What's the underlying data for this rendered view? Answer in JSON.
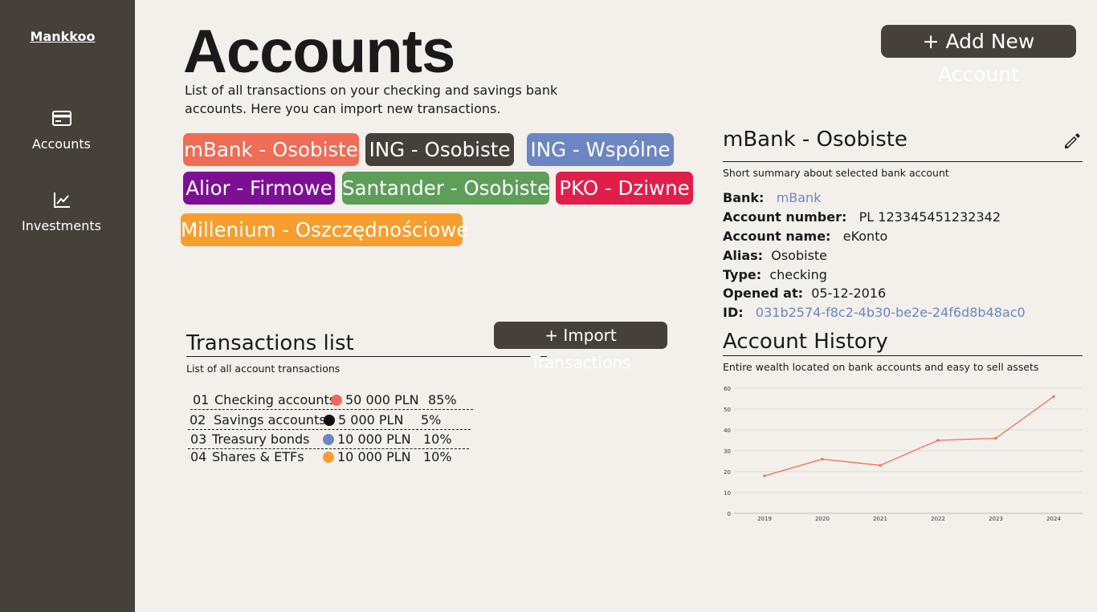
{
  "sidebar": {
    "logo": "Mankkoo",
    "items": [
      {
        "label": "Accounts",
        "icon": "credit-card-icon"
      },
      {
        "label": "Investments",
        "icon": "chart-line-icon"
      }
    ]
  },
  "header": {
    "title": "Accounts",
    "subtitle": "List of all transactions on your checking and savings bank accounts. Here you can import new transactions.",
    "add_button": "+ Add New Account"
  },
  "accounts": [
    {
      "label": "mBank - Osobiste",
      "color": "#ef6c55"
    },
    {
      "label": "ING - Osobiste",
      "color": "#46403b"
    },
    {
      "label": "ING - Wspólne",
      "color": "#6b86c2"
    },
    {
      "label": "Alior - Firmowe",
      "color": "#7d0f95"
    },
    {
      "label": "Santander - Osobiste",
      "color": "#5d9e58"
    },
    {
      "label": "PKO - Dziwne",
      "color": "#e01e4a"
    },
    {
      "label": "Millenium - Oszczędnościowe",
      "color": "#f79e2f"
    }
  ],
  "transactions": {
    "title": "Transactions list",
    "subtitle": "List of all account transactions",
    "import_button": "+ Import Transactions",
    "rows": [
      {
        "no": "01",
        "name": "Checking accounts",
        "color": "#ef6c55",
        "amount": "50 000 PLN",
        "percent": "85%"
      },
      {
        "no": "02",
        "name": "Savings accounts",
        "color": "#111111",
        "amount": "5 000 PLN",
        "percent": "5%"
      },
      {
        "no": "03",
        "name": "Treasury bonds",
        "color": "#6b86c2",
        "amount": "10 000 PLN",
        "percent": "10%"
      },
      {
        "no": "04",
        "name": "Shares & ETFs",
        "color": "#f79e2f",
        "amount": "10 000 PLN",
        "percent": "10%"
      }
    ]
  },
  "details": {
    "title": "mBank - Osobiste",
    "subtitle": "Short summary about selected bank account",
    "fields": [
      {
        "label": "Bank:",
        "value": "mBank"
      },
      {
        "label": "Account number:",
        "value": "PL 123345451232342"
      },
      {
        "label": "Account name:",
        "value": "eKonto"
      },
      {
        "label": "Alias:",
        "value": "Osobiste"
      },
      {
        "label": "Type:",
        "value": "checking"
      },
      {
        "label": "Opened at:",
        "value": "05-12-2016"
      },
      {
        "label": "ID:",
        "value": "031b2574-f8c2-4b30-be2e-24f6d8b48ac0"
      }
    ]
  },
  "history": {
    "title": "Account History",
    "subtitle": "Entire wealth located on bank accounts and easy to sell assets"
  },
  "chart_data": {
    "type": "line",
    "categories": [
      "2019",
      "2020",
      "2021",
      "2022",
      "2023",
      "2024"
    ],
    "series": [
      {
        "values": [
          18,
          26,
          23,
          35,
          36,
          56
        ],
        "color": "#ef6c55"
      }
    ],
    "yticks": [
      0,
      10,
      20,
      30,
      40,
      50,
      60
    ],
    "ylim": [
      0,
      60
    ],
    "grid": true,
    "title": "",
    "xlabel": "",
    "ylabel": ""
  }
}
